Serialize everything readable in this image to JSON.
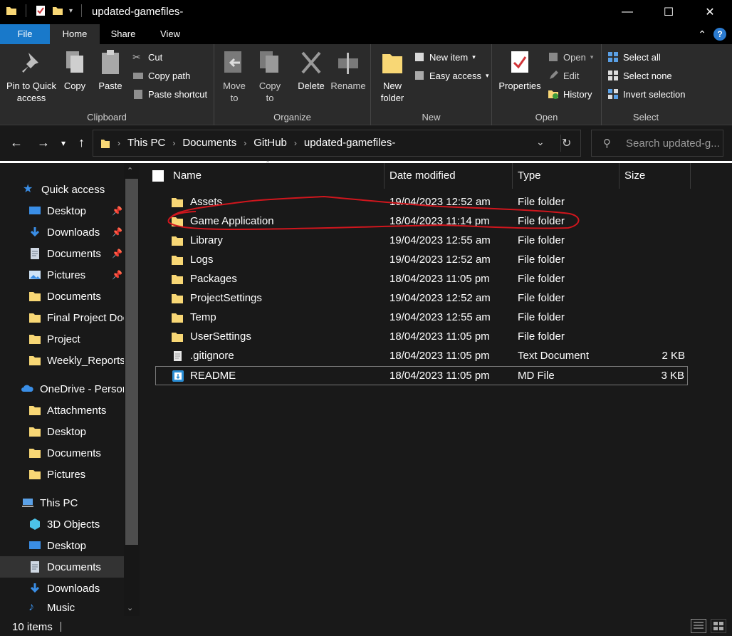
{
  "window": {
    "title": "updated-gamefiles-",
    "minimize": "—",
    "maximize": "☐",
    "close": "✕"
  },
  "tabs": {
    "file": "File",
    "home": "Home",
    "share": "Share",
    "view": "View"
  },
  "ribbon": {
    "clipboard": {
      "label": "Clipboard",
      "pin": "Pin to Quick access",
      "copy": "Copy",
      "paste": "Paste",
      "cut": "Cut",
      "copy_path": "Copy path",
      "paste_shortcut": "Paste shortcut"
    },
    "organize": {
      "label": "Organize",
      "move_to": "Move to",
      "copy_to": "Copy to",
      "delete": "Delete",
      "rename": "Rename"
    },
    "new": {
      "label": "New",
      "new_folder": "New folder",
      "new_item": "New item",
      "easy_access": "Easy access"
    },
    "open": {
      "label": "Open",
      "properties": "Properties",
      "open": "Open",
      "edit": "Edit",
      "history": "History"
    },
    "select": {
      "label": "Select",
      "select_all": "Select all",
      "select_none": "Select none",
      "invert": "Invert selection"
    }
  },
  "address": {
    "crumbs": [
      "This PC",
      "Documents",
      "GitHub",
      "updated-gamefiles-"
    ],
    "search_placeholder": "Search updated-g..."
  },
  "sidebar": {
    "quick_access": "Quick access",
    "quick_items": [
      {
        "label": "Desktop",
        "pinned": true,
        "icon": "desktop-icon"
      },
      {
        "label": "Downloads",
        "pinned": true,
        "icon": "downloads-icon"
      },
      {
        "label": "Documents",
        "pinned": true,
        "icon": "documents-icon"
      },
      {
        "label": "Pictures",
        "pinned": true,
        "icon": "pictures-icon"
      },
      {
        "label": "Documents",
        "pinned": false,
        "icon": "folder-icon"
      },
      {
        "label": "Final Project Doc",
        "pinned": false,
        "icon": "folder-icon"
      },
      {
        "label": "Project",
        "pinned": false,
        "icon": "folder-icon"
      },
      {
        "label": "Weekly_Reports",
        "pinned": false,
        "icon": "folder-icon"
      }
    ],
    "onedrive": "OneDrive - Person",
    "onedrive_items": [
      "Attachments",
      "Desktop",
      "Documents",
      "Pictures"
    ],
    "this_pc": "This PC",
    "pc_items": [
      "3D Objects",
      "Desktop",
      "Documents",
      "Downloads",
      "Music"
    ]
  },
  "columns": {
    "name": "Name",
    "date": "Date modified",
    "type": "Type",
    "size": "Size"
  },
  "files": [
    {
      "name": "Assets",
      "date": "19/04/2023 12:52 am",
      "type": "File folder",
      "size": "",
      "icon": "folder-icon"
    },
    {
      "name": "Game Application",
      "date": "18/04/2023 11:14 pm",
      "type": "File folder",
      "size": "",
      "icon": "folder-icon"
    },
    {
      "name": "Library",
      "date": "19/04/2023 12:55 am",
      "type": "File folder",
      "size": "",
      "icon": "folder-icon"
    },
    {
      "name": "Logs",
      "date": "19/04/2023 12:52 am",
      "type": "File folder",
      "size": "",
      "icon": "folder-icon"
    },
    {
      "name": "Packages",
      "date": "18/04/2023 11:05 pm",
      "type": "File folder",
      "size": "",
      "icon": "folder-icon"
    },
    {
      "name": "ProjectSettings",
      "date": "19/04/2023 12:52 am",
      "type": "File folder",
      "size": "",
      "icon": "folder-icon"
    },
    {
      "name": "Temp",
      "date": "19/04/2023 12:55 am",
      "type": "File folder",
      "size": "",
      "icon": "folder-icon"
    },
    {
      "name": "UserSettings",
      "date": "18/04/2023 11:05 pm",
      "type": "File folder",
      "size": "",
      "icon": "folder-icon"
    },
    {
      "name": ".gitignore",
      "date": "18/04/2023 11:05 pm",
      "type": "Text Document",
      "size": "2 KB",
      "icon": "text-file-icon"
    },
    {
      "name": "README",
      "date": "18/04/2023 11:05 pm",
      "type": "MD File",
      "size": "3 KB",
      "icon": "md-file-icon"
    }
  ],
  "status": {
    "items": "10 items"
  },
  "colors": {
    "accent": "#1979ca",
    "folder": "#f8d775",
    "annotation": "#d0161d"
  }
}
